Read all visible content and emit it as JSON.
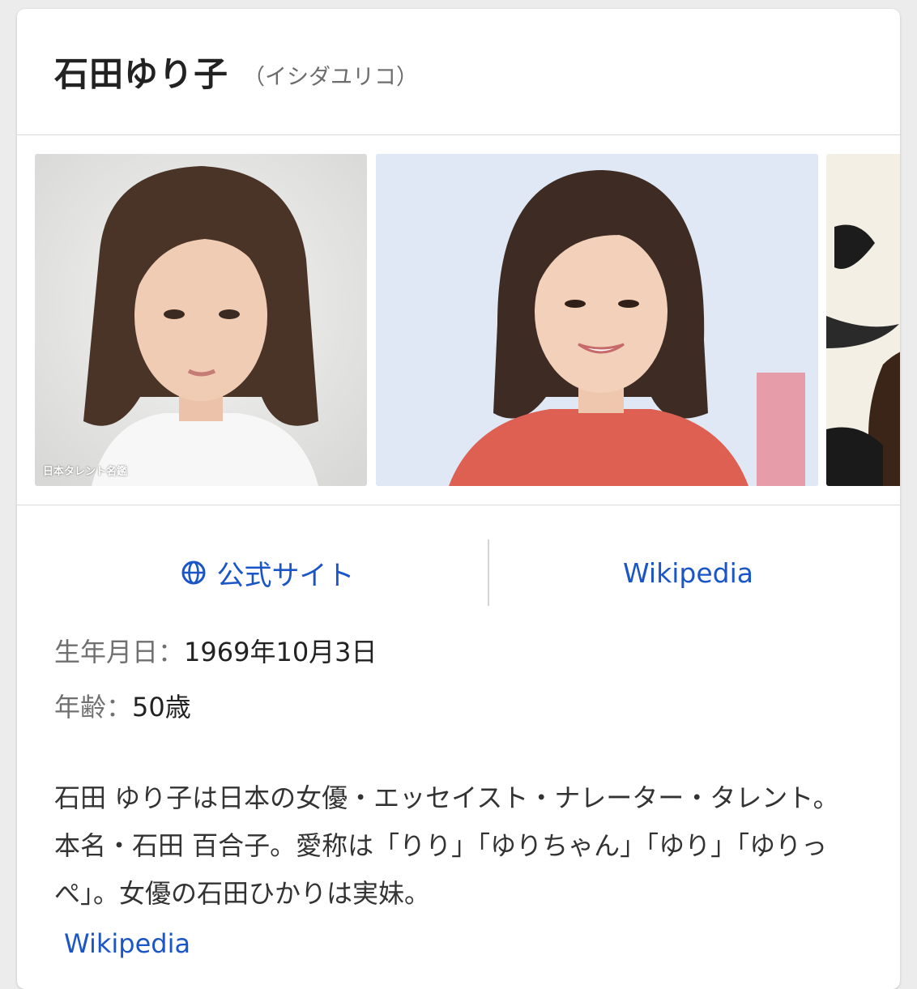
{
  "header": {
    "name": "石田ゆり子",
    "reading": "（イシダユリコ）"
  },
  "images": {
    "watermark": "日本タレント名鑑"
  },
  "links": {
    "official_label": "公式サイト",
    "wikipedia_label": "Wikipedia"
  },
  "facts": [
    {
      "key": "生年月日：",
      "value": "1969年10月3日"
    },
    {
      "key": "年齢：",
      "value": "50歳"
    }
  ],
  "description": {
    "text": "石田 ゆり子は日本の女優・エッセイスト・ナレーター・タレント。本名・石田 百合子。愛称は「りり」「ゆりちゃん」「ゆり」「ゆりっぺ」。女優の石田ひかりは実妹。",
    "source_label": "Wikipedia"
  },
  "colors": {
    "link": "#1a56c8",
    "title": "#222222",
    "divider": "#dadada"
  },
  "icons": {
    "official_site": "globe-icon"
  }
}
